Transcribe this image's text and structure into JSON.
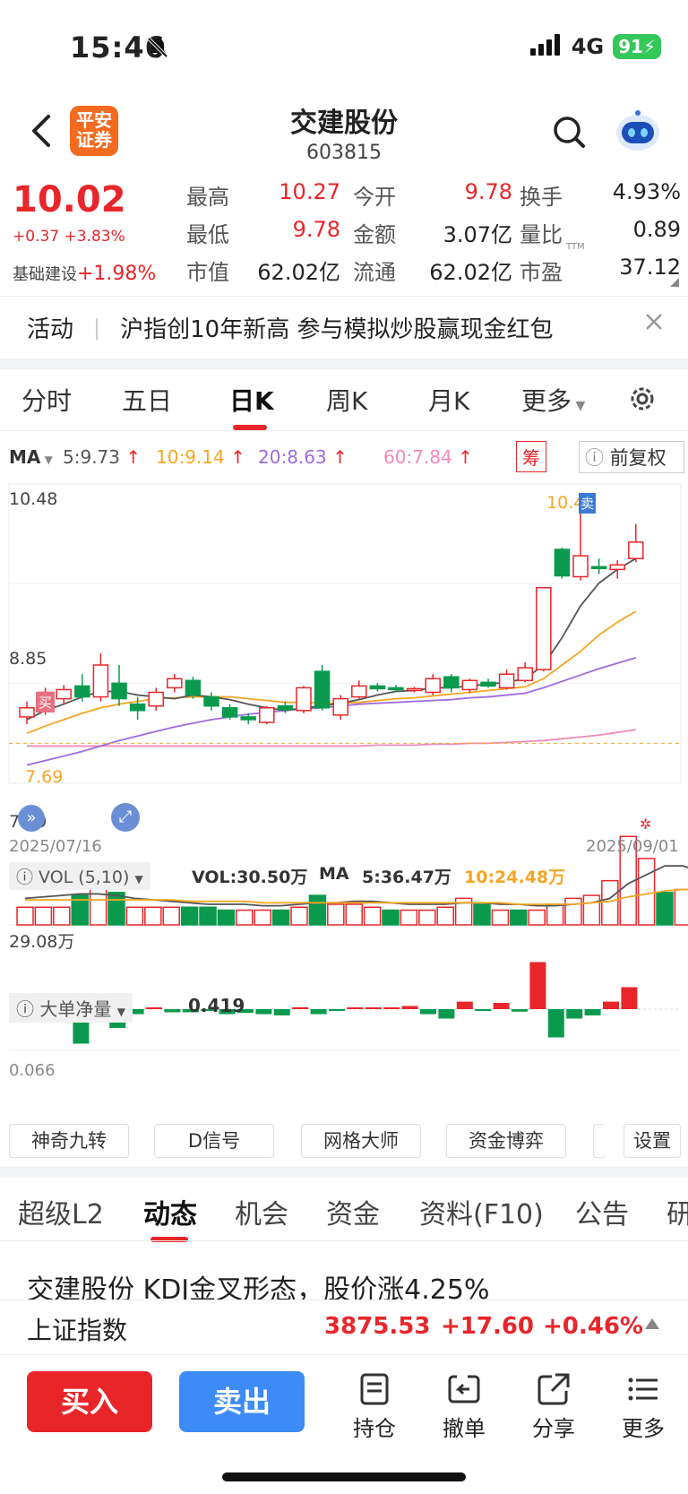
{
  "status_bar": {
    "time": "15:46",
    "network": "4G",
    "battery": "91"
  },
  "header": {
    "broker_logo": "平安\n证券",
    "stock_name": "交建股份",
    "stock_code": "603815"
  },
  "quote": {
    "price": "10.02",
    "change": "+0.37 +3.83%",
    "sector_label": "基础建设",
    "sector_change": "+1.98%",
    "fields": [
      [
        {
          "label": "最高",
          "value": "10.27",
          "color": "red"
        },
        {
          "label": "今开",
          "value": "9.78",
          "color": "red"
        },
        {
          "label": "换手",
          "value": "4.93%",
          "color": "dark"
        }
      ],
      [
        {
          "label": "最低",
          "value": "9.78",
          "color": "red"
        },
        {
          "label": "金额",
          "value": "3.07亿",
          "color": "dark"
        },
        {
          "label": "量比",
          "value": "0.89",
          "color": "dark"
        }
      ],
      [
        {
          "label": "市值",
          "value": "62.02亿",
          "color": "dark"
        },
        {
          "label": "流通",
          "value": "62.02亿",
          "color": "dark"
        },
        {
          "label": "市盈",
          "value": "37.12",
          "color": "dark",
          "sup": "TTM"
        }
      ]
    ]
  },
  "activity": {
    "label": "活动",
    "text": "沪指创10年新高 参与模拟炒股赢现金红包"
  },
  "period_tabs": [
    "分时",
    "五日",
    "日K",
    "周K",
    "月K",
    "更多"
  ],
  "active_period": 2,
  "ma_legend": {
    "prefix": "MA",
    "ma5": "5:9.73",
    "ma10": "10:9.14",
    "ma20": "20:8.63",
    "ma60": "60:7.84",
    "chip_btn": "筹",
    "adjust_btn": "前复权"
  },
  "chart_labels": {
    "price_high": "10.48",
    "price_mid": "8.85",
    "price_low_marker": "7.69",
    "price_min": "7.29",
    "top_marker": "10.4",
    "sell_tag": "卖",
    "buy_tag": "买",
    "date_start": "2025/07/16",
    "date_end": "2025/09/01"
  },
  "vol_panel": {
    "title": "VOL (5,10)",
    "vol": "VOL:30.50万",
    "ma_prefix": "MA",
    "ma5": "5:36.47万",
    "ma10": "10:24.48万",
    "axis_label": "29.08万"
  },
  "bigorder_panel": {
    "title": "大单净量",
    "value": "0.419",
    "axis_label": "0.066"
  },
  "tools": [
    "神奇九转",
    "D信号",
    "网格大师",
    "资金博弈",
    "设置"
  ],
  "bottom_tabs": [
    "超级L2",
    "动态",
    "机会",
    "资金",
    "资料(F10)",
    "公告",
    "研"
  ],
  "active_bottom_tab": 1,
  "news_headline": "交建股份 KDJ金叉形态，股价涨4.25%",
  "index_bar": {
    "name": "上证指数",
    "value": "3875.53",
    "change": "+17.60",
    "pct": "+0.46%"
  },
  "actions": {
    "buy": "买入",
    "sell": "卖出",
    "items": [
      "持仓",
      "撤单",
      "分享",
      "更多"
    ]
  },
  "colors": {
    "up": "#e8262a",
    "down": "#0a9a4e",
    "ma5": "#555555",
    "ma10": "#f5a623",
    "ma20": "#a06bdc",
    "ma60": "#f08ab8"
  },
  "chart_data": {
    "type": "candlestick",
    "x_range": [
      "2025/07/16",
      "2025/09/01"
    ],
    "ylim": [
      7.29,
      10.48
    ],
    "candles": [
      {
        "o": 7.98,
        "c": 8.08,
        "h": 8.15,
        "l": 7.9
      },
      {
        "o": 8.05,
        "c": 8.25,
        "h": 8.3,
        "l": 8.0
      },
      {
        "o": 8.18,
        "c": 8.28,
        "h": 8.33,
        "l": 8.12
      },
      {
        "o": 8.32,
        "c": 8.2,
        "h": 8.45,
        "l": 8.15
      },
      {
        "o": 8.2,
        "c": 8.55,
        "h": 8.68,
        "l": 8.15
      },
      {
        "o": 8.35,
        "c": 8.18,
        "h": 8.55,
        "l": 8.1
      },
      {
        "o": 8.12,
        "c": 8.05,
        "h": 8.2,
        "l": 7.95
      },
      {
        "o": 8.1,
        "c": 8.25,
        "h": 8.3,
        "l": 8.05
      },
      {
        "o": 8.3,
        "c": 8.4,
        "h": 8.45,
        "l": 8.25
      },
      {
        "o": 8.38,
        "c": 8.22,
        "h": 8.42,
        "l": 8.18
      },
      {
        "o": 8.2,
        "c": 8.1,
        "h": 8.25,
        "l": 8.05
      },
      {
        "o": 8.08,
        "c": 7.98,
        "h": 8.12,
        "l": 7.95
      },
      {
        "o": 7.98,
        "c": 7.95,
        "h": 8.02,
        "l": 7.9
      },
      {
        "o": 7.92,
        "c": 8.08,
        "h": 8.1,
        "l": 7.9
      },
      {
        "o": 8.1,
        "c": 8.06,
        "h": 8.15,
        "l": 8.02
      },
      {
        "o": 8.05,
        "c": 8.3,
        "h": 8.32,
        "l": 8.02
      },
      {
        "o": 8.48,
        "c": 8.08,
        "h": 8.55,
        "l": 8.05
      },
      {
        "o": 8.0,
        "c": 8.18,
        "h": 8.22,
        "l": 7.95
      },
      {
        "o": 8.2,
        "c": 8.32,
        "h": 8.38,
        "l": 8.18
      },
      {
        "o": 8.32,
        "c": 8.29,
        "h": 8.35,
        "l": 8.26
      },
      {
        "o": 8.3,
        "c": 8.28,
        "h": 8.33,
        "l": 8.25
      },
      {
        "o": 8.28,
        "c": 8.29,
        "h": 8.31,
        "l": 8.25
      },
      {
        "o": 8.25,
        "c": 8.4,
        "h": 8.45,
        "l": 8.22
      },
      {
        "o": 8.42,
        "c": 8.3,
        "h": 8.45,
        "l": 8.25
      },
      {
        "o": 8.28,
        "c": 8.38,
        "h": 8.4,
        "l": 8.24
      },
      {
        "o": 8.36,
        "c": 8.32,
        "h": 8.4,
        "l": 8.3
      },
      {
        "o": 8.3,
        "c": 8.45,
        "h": 8.5,
        "l": 8.28
      },
      {
        "o": 8.38,
        "c": 8.52,
        "h": 8.58,
        "l": 8.36
      },
      {
        "o": 8.5,
        "c": 9.4,
        "h": 9.4,
        "l": 8.48
      },
      {
        "o": 9.82,
        "c": 9.53,
        "h": 9.84,
        "l": 9.5
      },
      {
        "o": 9.52,
        "c": 9.75,
        "h": 10.4,
        "l": 9.48
      },
      {
        "o": 9.63,
        "c": 9.62,
        "h": 9.72,
        "l": 9.55
      },
      {
        "o": 9.6,
        "c": 9.65,
        "h": 9.7,
        "l": 9.5
      },
      {
        "o": 9.72,
        "c": 9.9,
        "h": 10.1,
        "l": 9.68
      }
    ],
    "ma5": [
      7.95,
      8.05,
      8.12,
      8.2,
      8.26,
      8.26,
      8.22,
      8.2,
      8.18,
      8.22,
      8.2,
      8.17,
      8.12,
      8.08,
      8.05,
      8.08,
      8.1,
      8.13,
      8.17,
      8.22,
      8.26,
      8.27,
      8.3,
      8.3,
      8.32,
      8.34,
      8.36,
      8.4,
      8.55,
      8.85,
      9.2,
      9.45,
      9.6,
      9.72
    ],
    "ma10": [
      7.8,
      7.88,
      7.95,
      8.02,
      8.08,
      8.12,
      8.15,
      8.18,
      8.19,
      8.2,
      8.2,
      8.2,
      8.18,
      8.16,
      8.14,
      8.14,
      8.13,
      8.13,
      8.14,
      8.16,
      8.18,
      8.19,
      8.21,
      8.23,
      8.25,
      8.27,
      8.29,
      8.31,
      8.4,
      8.55,
      8.7,
      8.88,
      9.02,
      9.14
    ],
    "ma20": [
      7.45,
      7.5,
      7.55,
      7.6,
      7.66,
      7.72,
      7.77,
      7.82,
      7.87,
      7.91,
      7.95,
      7.98,
      8.01,
      8.03,
      8.05,
      8.07,
      8.08,
      8.1,
      8.12,
      8.13,
      8.14,
      8.15,
      8.16,
      8.17,
      8.19,
      8.2,
      8.22,
      8.24,
      8.3,
      8.37,
      8.44,
      8.51,
      8.57,
      8.63
    ],
    "ma60": [
      7.66,
      7.66,
      7.66,
      7.66,
      7.66,
      7.66,
      7.66,
      7.66,
      7.66,
      7.66,
      7.66,
      7.66,
      7.66,
      7.66,
      7.66,
      7.66,
      7.66,
      7.66,
      7.66,
      7.67,
      7.67,
      7.67,
      7.68,
      7.68,
      7.69,
      7.69,
      7.7,
      7.71,
      7.72,
      7.74,
      7.76,
      7.78,
      7.81,
      7.84
    ],
    "volume_wan": [
      12,
      12,
      12,
      20,
      28,
      22,
      12,
      12,
      12,
      12,
      12,
      10,
      10,
      10,
      10,
      12,
      20,
      14,
      14,
      12,
      10,
      10,
      10,
      12,
      18,
      14,
      10,
      10,
      10,
      14,
      18,
      20,
      30,
      60,
      45,
      22,
      24,
      30
    ],
    "vol_up": [
      1,
      1,
      1,
      0,
      1,
      0,
      1,
      1,
      1,
      0,
      0,
      0,
      1,
      1,
      0,
      1,
      0,
      1,
      1,
      1,
      0,
      1,
      1,
      1,
      1,
      0,
      1,
      0,
      1,
      1,
      1,
      1,
      1,
      1,
      1,
      0,
      1,
      1
    ],
    "vol_ma5": [
      18,
      19,
      20,
      21,
      21,
      20,
      18,
      17,
      16,
      15,
      14,
      14,
      14,
      13,
      13,
      14,
      15,
      15,
      16,
      16,
      15,
      14,
      14,
      14,
      15,
      15,
      14,
      14,
      13,
      13,
      14,
      15,
      18,
      28,
      34,
      40,
      40,
      36
    ],
    "vol_ma10": [
      17,
      17,
      17,
      17,
      17,
      17,
      17,
      17,
      17,
      16,
      16,
      16,
      16,
      15,
      15,
      15,
      15,
      15,
      15,
      15,
      15,
      15,
      15,
      15,
      15,
      15,
      15,
      14,
      14,
      14,
      14,
      15,
      16,
      19,
      21,
      23,
      24,
      24
    ],
    "big_order_net": [
      0,
      -0.55,
      0.25,
      -0.3,
      -0.08,
      0.02,
      -0.05,
      -0.05,
      -0.02,
      -0.08,
      -0.06,
      -0.08,
      -0.1,
      0.03,
      -0.08,
      -0.03,
      0.02,
      0.02,
      0.02,
      0.05,
      -0.08,
      -0.15,
      0.12,
      -0.03,
      0.1,
      -0.04,
      0.75,
      -0.45,
      -0.15,
      -0.1,
      0.12,
      0.35
    ]
  }
}
